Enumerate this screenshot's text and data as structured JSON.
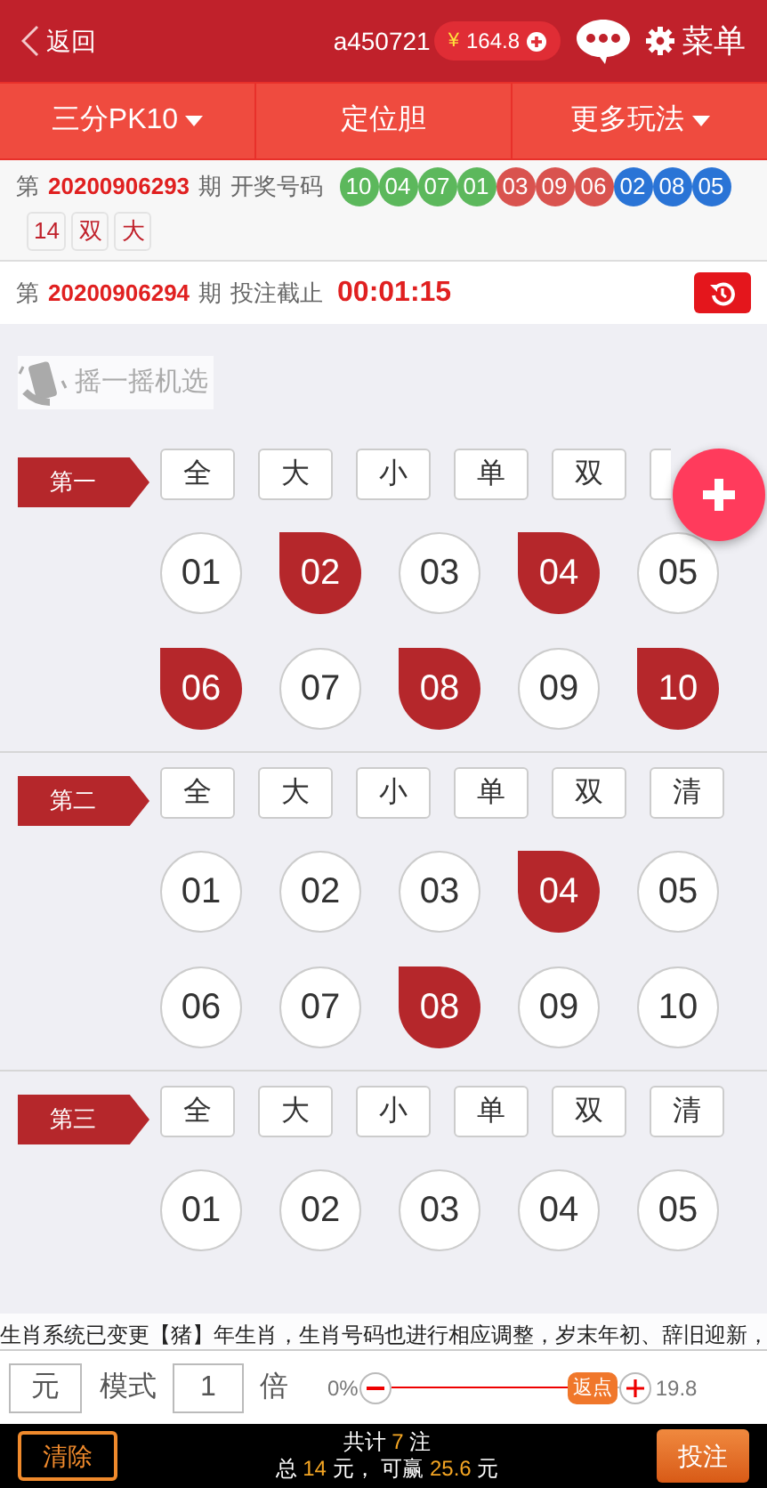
{
  "header": {
    "back_label": "返回",
    "username": "a450721",
    "currency": "¥",
    "balance": "164.8",
    "menu_label": "菜单"
  },
  "tabs": [
    {
      "label": "三分PK10",
      "dropdown": true
    },
    {
      "label": "定位胆",
      "dropdown": false
    },
    {
      "label": "更多玩法",
      "dropdown": true
    }
  ],
  "last_draw": {
    "prefix": "第",
    "issue": "20200906293",
    "suffix": "期",
    "label": "开奖号码",
    "balls": [
      {
        "number": "10",
        "color": "#5cb85c"
      },
      {
        "number": "04",
        "color": "#5cb85c"
      },
      {
        "number": "07",
        "color": "#5cb85c"
      },
      {
        "number": "01",
        "color": "#5cb85c"
      },
      {
        "number": "03",
        "color": "#d9534f"
      },
      {
        "number": "09",
        "color": "#d9534f"
      },
      {
        "number": "06",
        "color": "#d9534f"
      },
      {
        "number": "02",
        "color": "#2a74d6"
      },
      {
        "number": "08",
        "color": "#2a74d6"
      },
      {
        "number": "05",
        "color": "#2a74d6"
      }
    ],
    "tags": [
      "14",
      "双",
      "大"
    ]
  },
  "next_draw": {
    "prefix": "第",
    "issue": "20200906294",
    "suffix": "期",
    "label": "投注截止",
    "countdown": "00:01:15"
  },
  "shake_label": "摇一摇机选",
  "sections": [
    {
      "label": "第一",
      "quick": [
        "全",
        "大",
        "小",
        "单",
        "双"
      ],
      "covered_chip": true,
      "balls": [
        {
          "number": "01",
          "selected": false
        },
        {
          "number": "02",
          "selected": true
        },
        {
          "number": "03",
          "selected": false
        },
        {
          "number": "04",
          "selected": true
        },
        {
          "number": "05",
          "selected": false
        },
        {
          "number": "06",
          "selected": true
        },
        {
          "number": "07",
          "selected": false
        },
        {
          "number": "08",
          "selected": true
        },
        {
          "number": "09",
          "selected": false
        },
        {
          "number": "10",
          "selected": true
        }
      ]
    },
    {
      "label": "第二",
      "quick": [
        "全",
        "大",
        "小",
        "单",
        "双",
        "清"
      ],
      "balls": [
        {
          "number": "01",
          "selected": false
        },
        {
          "number": "02",
          "selected": false
        },
        {
          "number": "03",
          "selected": false
        },
        {
          "number": "04",
          "selected": true
        },
        {
          "number": "05",
          "selected": false
        },
        {
          "number": "06",
          "selected": false
        },
        {
          "number": "07",
          "selected": false
        },
        {
          "number": "08",
          "selected": true
        },
        {
          "number": "09",
          "selected": false
        },
        {
          "number": "10",
          "selected": false
        }
      ]
    },
    {
      "label": "第三",
      "quick": [
        "全",
        "大",
        "小",
        "单",
        "双",
        "清"
      ],
      "balls": [
        {
          "number": "01",
          "selected": false
        },
        {
          "number": "02",
          "selected": false
        },
        {
          "number": "03",
          "selected": false
        },
        {
          "number": "04",
          "selected": false
        },
        {
          "number": "05",
          "selected": false
        }
      ]
    }
  ],
  "marquee": "生肖系统已变更【猪】年生肖，生肖号码也进行相应调整，岁末年初、辞旧迎新，",
  "controls": {
    "unit": "元",
    "mode_label": "模式",
    "multiplier": "1",
    "times_label": "倍",
    "min_label": "0%",
    "thumb_label": "返点",
    "level": 0.88,
    "max_label": "19.8"
  },
  "footer": {
    "clear": "清除",
    "summary": [
      [
        {
          "text": "共计 ",
          "highlight": false
        },
        {
          "text": "7",
          "highlight": true
        },
        {
          "text": " 注",
          "highlight": false
        }
      ],
      [
        {
          "text": "总 ",
          "highlight": false
        },
        {
          "text": "14",
          "highlight": true
        },
        {
          "text": " 元， 可赢 ",
          "highlight": false
        },
        {
          "text": "25.6",
          "highlight": true
        },
        {
          "text": " 元",
          "highlight": false
        }
      ]
    ],
    "submit": "投注"
  }
}
